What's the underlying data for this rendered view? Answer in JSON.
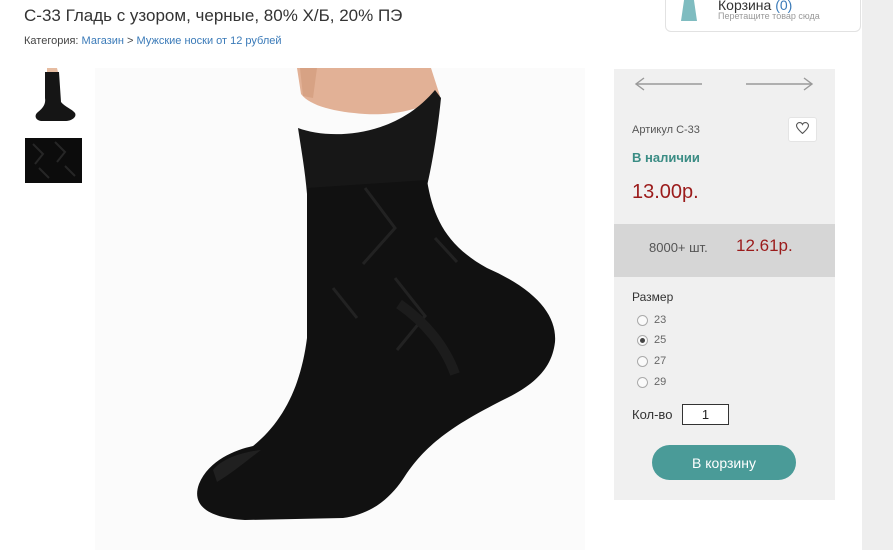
{
  "product": {
    "title": "С-33 Гладь с узором, черные, 80% Х/Б, 20% ПЭ",
    "category_label": "Категория:",
    "breadcrumb": [
      "Магазин",
      "Мужские носки от 12 рублей"
    ],
    "breadcrumb_sep": ">"
  },
  "cart": {
    "title": "Корзина",
    "count": "(0)",
    "hint": "Перетащите товар сюда"
  },
  "panel": {
    "sku": "Артикул С-33",
    "stock": "В наличии",
    "price": "13.00р.",
    "bulk_qty": "8000+ шт.",
    "bulk_price": "12.61р.",
    "size_label": "Размер",
    "sizes": [
      "23",
      "25",
      "27",
      "29"
    ],
    "selected_size": "25",
    "qty_label": "Кол-во",
    "qty_value": "1",
    "add_to_cart": "В корзину"
  },
  "icons": {
    "prev": "arrow-left-icon",
    "next": "arrow-right-icon",
    "favorite": "heart-icon",
    "cart": "shopping-bag-icon"
  },
  "colors": {
    "accent": "#4a9b98",
    "price": "#9b1b1b",
    "stock": "#3a8c84",
    "link": "#3a7ab8"
  }
}
